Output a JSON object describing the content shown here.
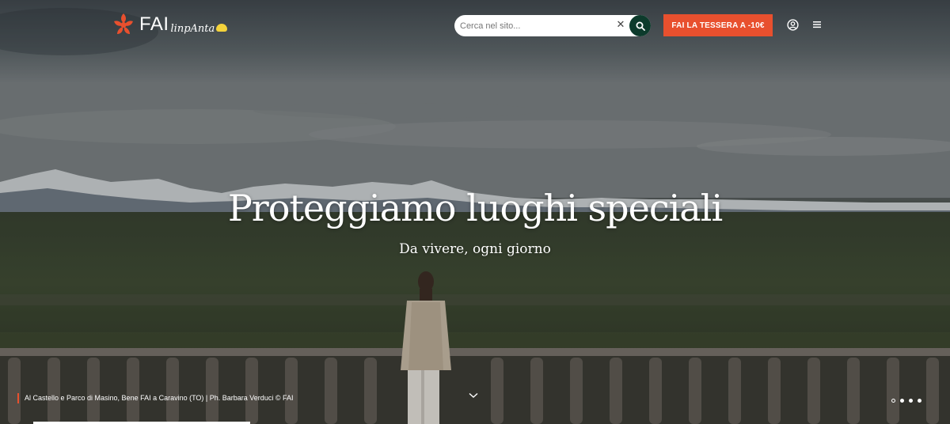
{
  "header": {
    "logo_text": "FAI",
    "logo_script": "linpAnta",
    "search": {
      "placeholder": "Cerca nel sito..."
    },
    "cta_label": "FAI LA TESSERA A -10€"
  },
  "hero": {
    "title": "Proteggiamo luoghi speciali",
    "subtitle": "Da vivere, ogni giorno",
    "caption": "Al Castello e Parco di Masino, Bene FAI a Caravino (TO) | Ph. Barbara Verduci © FAI",
    "slides_count": 4,
    "active_slide": 1
  },
  "icons": {
    "logo": "fai-logo-icon",
    "clear": "close-icon",
    "search": "search-icon",
    "user": "user-icon",
    "menu": "hamburger-menu-icon",
    "scroll": "chevron-down-icon"
  },
  "colors": {
    "accent": "#e8502e",
    "search_button": "#0d3b2c",
    "text": "#ffffff"
  }
}
